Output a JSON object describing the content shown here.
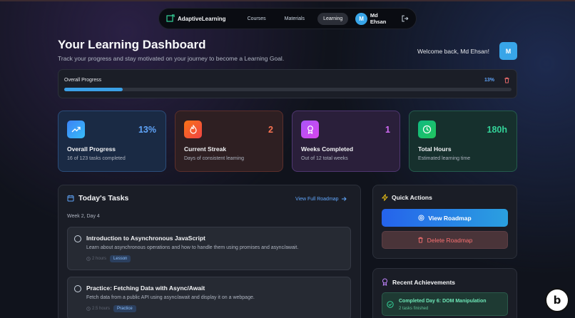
{
  "nav": {
    "brand": "AdaptiveLearning",
    "links": [
      "Courses",
      "Materials",
      "Learning"
    ],
    "active": "Learning",
    "user_initial": "M",
    "user_name": "Md Ehsan"
  },
  "header": {
    "title": "Your Learning Dashboard",
    "subtitle": "Track your progress and stay motivated on your journey to become a Learning Goal.",
    "welcome": "Welcome back, Md Ehsan!",
    "avatar_initial": "M"
  },
  "overall": {
    "label": "Overall Progress",
    "percent_text": "13%",
    "percent": 13
  },
  "stats": [
    {
      "value": "13%",
      "title": "Overall Progress",
      "subtitle": "16 of 123 tasks completed",
      "color": "#60a5fa"
    },
    {
      "value": "2",
      "title": "Current Streak",
      "subtitle": "Days of consistent learning",
      "color": "#f97352"
    },
    {
      "value": "1",
      "title": "Weeks Completed",
      "subtitle": "Out of 12 total weeks",
      "color": "#d16bf5"
    },
    {
      "value": "180h",
      "title": "Total Hours",
      "subtitle": "Estimated learning time",
      "color": "#34d399"
    }
  ],
  "tasks": {
    "title": "Today's Tasks",
    "roadmap_link": "View Full Roadmap",
    "week": "Week 2, Day 4",
    "items": [
      {
        "title": "Introduction to Asynchronous JavaScript",
        "description": "Learn about asynchronous operations and how to handle them using promises and async/await.",
        "time": "2 hours",
        "tag": "Lesson"
      },
      {
        "title": "Practice: Fetching Data with Async/Await",
        "description": "Fetch data from a public API using async/await and display it on a webpage.",
        "time": "2.5 hours",
        "tag": "Practice"
      }
    ]
  },
  "quick_actions": {
    "title": "Quick Actions",
    "view_roadmap": "View Roadmap",
    "delete_roadmap": "Delete Roadmap"
  },
  "achievements": {
    "title": "Recent Achievements",
    "items": [
      {
        "name": "Completed Day 6: DOM Manipulation",
        "detail": "2 tasks finished"
      }
    ]
  },
  "badge_letter": "b"
}
